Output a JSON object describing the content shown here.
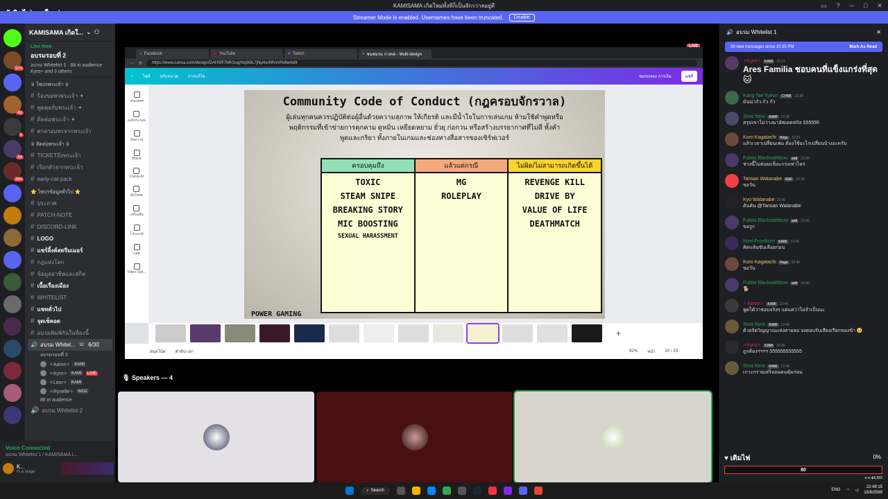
{
  "window": {
    "title": "KAMISAMA เกิดใหม่ทั้งทีก็เป็นจักรวาลอยู่ดี",
    "overlay_title": "ผู้เดิมไฟรายใหญ่",
    "controls": [
      "▭",
      "?",
      "─",
      "□",
      "✕"
    ]
  },
  "streamer": {
    "text": "Streamer Mode is enabled. Usernames have been truncated.",
    "disable_label": "Disable"
  },
  "server": {
    "name": "KAMISAMA เกิดใ...",
    "live_now": "Live Now",
    "stage_title": "อบรมรอบที่ 2",
    "audience": "อบรม Whitelist 1 · 88 in audience",
    "others": "Kyro+ and 3 others"
  },
  "channels": [
    {
      "kind": "cat",
      "label": "♛ ไซบรพระเจ้า ♛"
    },
    {
      "kind": "ch",
      "label": "ร้องขอพรพระเจ้า ✦"
    },
    {
      "kind": "ch",
      "label": "พูดคุยกับพระเจ้า ✦"
    },
    {
      "kind": "ch",
      "label": "ติดต่อพระเจ้า ✦"
    },
    {
      "kind": "ch",
      "label": "ศาลาอบพรจากพระเจ้า"
    },
    {
      "kind": "cat",
      "label": "♛ ติดต่อพระเจ้า ♛"
    },
    {
      "kind": "ch",
      "label": "TICKETถึงพระเจ้า"
    },
    {
      "kind": "ch",
      "label": "เรียกตัวจากพระเจ้า"
    },
    {
      "kind": "ch",
      "label": "early-cat-pack"
    },
    {
      "kind": "cat",
      "label": "⭐ ไซบรข้อมูลทั่วไป ⭐"
    },
    {
      "kind": "ch",
      "label": "ประกาศ"
    },
    {
      "kind": "ch",
      "label": "PATCH-NOTE"
    },
    {
      "kind": "ch",
      "label": "DISCORD-LINK"
    },
    {
      "kind": "ch",
      "label": "LOGO",
      "w": true
    },
    {
      "kind": "ch",
      "label": "แชร์ลิ้งค์สตรีมเมอร์",
      "w": true
    },
    {
      "kind": "ch",
      "label": "กฎแห่งโลก"
    },
    {
      "kind": "ch",
      "label": "ข้อมูลอาชีพและสกิล"
    },
    {
      "kind": "ch",
      "label": "เนื้อเรื่องเมือง",
      "w": true
    },
    {
      "kind": "ch",
      "label": "WHITELIST"
    },
    {
      "kind": "ch",
      "label": "แชทคั่วไป",
      "w": true
    },
    {
      "kind": "ch",
      "label": "จุดเช็คอต",
      "w": true
    },
    {
      "kind": "ch",
      "label": "อบรมพิมพ์กันในห้องนี้"
    }
  ],
  "voice_channel": {
    "name": "อบรม Whitel...",
    "count": "92",
    "limit": "6/30",
    "sub": "อบรมรอบที่ 2",
    "users": [
      {
        "name": "✧Aaron✧",
        "tag": "KAMI"
      },
      {
        "name": "✧Kyro✧",
        "tag": "KAMI",
        "live": "LIVE"
      },
      {
        "name": "✧Leor✧",
        "tag": "KAMI"
      },
      {
        "name": "✧Rynelle✧",
        "tag": "WOZ"
      }
    ],
    "audience": "88 in audience",
    "next": "อบรม Whitelist 2"
  },
  "voice_status": {
    "state": "Voice Connected",
    "sub": "อบรม Whitelist 1 / KAMISAMA L...",
    "user": "K...",
    "user_sub": "In a stage"
  },
  "browser": {
    "tabs": [
      "Facebook",
      "YouTube",
      "Twitch",
      "ชนชมรม กาสเด - Multi-design"
    ],
    "url": "https://www.canva.com/design/DAHSR7MKSug/Nq9ML7jNjAhoNfVmPk8w/edit",
    "live_badge": "LIVE"
  },
  "canva": {
    "top": [
      "ไฟล์",
      "ปรับขนาด",
      "การแก้ไข"
    ],
    "share": "แชร์",
    "user": "ชมรมของ การเงิน",
    "side": [
      "เทมเพลต",
      "องค์ประกอบ",
      "ข้อความ",
      "Brand",
      "Canva AI",
      "อัปโหลด",
      "เครื่องมือ",
      "โปรเจกต์",
      "แอพ",
      "Video Opti..."
    ],
    "notes": "สมุดโน้ต",
    "timer": "ตัวจับเวลา",
    "zoom": "62%",
    "pages": "20 / 23",
    "page_label": "หน้า"
  },
  "slide": {
    "title": "Community Code of Conduct (กฎครอบจักรวาล)",
    "desc": "ผู้เล่นทุกคนควรปฏิบัติต่อผู้อื่นด้วยความสุภาพ ให้เกียรติ และมีน้ำใจในการเล่นเกม ห้ามใช้คำพูดหรือพฤติกรรมที่เข้าข่ายการคุกคาม ดูหมิ่น เหยียดหยาม ยั่วยุ ก่อกวน หรือสร้างบรรยากาศที่ไม่ดี ทั้งคำพูดและกริยา ทั้งภายในเกมและช่องทางสื่อสารของเซิร์ฟเวอร์",
    "columns": [
      {
        "header": "ครอบคุมถึง",
        "color": "#93dfb8",
        "items": [
          "TOXIC",
          "STEAM SNIPE",
          "BREAKING STORY",
          "MIC BOOSTING",
          "SEXUAL HARASSMENT"
        ]
      },
      {
        "header": "แล้วแต่กรณี",
        "color": "#f4a97f",
        "items": [
          "MG",
          "ROLEPLAY"
        ]
      },
      {
        "header": "ไม่ผิด/ไม่สามารถเกิดขึ้นได้",
        "color": "#f8d32e",
        "items": [
          "REVENGE KILL",
          "DRIVE BY",
          "VALUE OF LIFE",
          "DEATHMATCH"
        ]
      }
    ],
    "footer": "POWER GAMING"
  },
  "stage": {
    "speakers": "Speakers — 4"
  },
  "chat": {
    "title": "อบรม Whitelist 1",
    "new_msgs": "50 new messages since 10:35 PM",
    "mark_read": "Mark As Read",
    "messages": [
      {
        "name": "✧Kyro✧",
        "tag": "KAMI",
        "time": "22:37",
        "text": "Ares Familia ชอบคนที่แข็งแกร่งที่สุด 🐱",
        "big": true,
        "color": "#e91e63"
      },
      {
        "name": "Kang Tae hyeon",
        "tag": "CYBR",
        "time": "22:38",
        "text": "มันน่ากัว กัว กัว",
        "color": "#23a55a"
      },
      {
        "name": "Sora Itano",
        "tag": "KAMI",
        "time": "22:38",
        "text": "สรุปเขาไม่ว่างมาอัพเดตสกิล 555555",
        "color": "#23a55a"
      },
      {
        "name": "Kuro Kagatachi",
        "tag": "Hogs",
        "time": "22:39",
        "text": "แล้วเวลาเปลี่ยนเฟม ต้องใช้อะไรเปลี่ยนบ้างอะครับ",
        "color": "#e5c07b"
      },
      {
        "name": "Fubito Blackoathbow",
        "tag": "add",
        "time": "22:39",
        "text": "ช่วงนี้ไม่ค่อยแข็งแกร่งเท่าไหร่",
        "color": "#23a55a"
      },
      {
        "name": "Tansan Watanabe",
        "tag": "RAF",
        "time": "22:39",
        "text": "ขอวัน",
        "color": "#e5c07b"
      },
      {
        "name": "Kyo Watanabe",
        "tag": "",
        "time": "22:40",
        "text": "ดันดัน @Tansan Watanabe",
        "color": "#e5c07b"
      },
      {
        "name": "Fubito Blackoathbow",
        "tag": "add",
        "time": "22:40",
        "text": "ขอรูก",
        "color": "#23a55a"
      },
      {
        "name": "Noel Frostborn",
        "tag": "KAMI",
        "time": "22:40",
        "text": "คิดแล้นขับเลือยก่อน",
        "color": "#23a55a"
      },
      {
        "name": "Kuro Kagatachi",
        "tag": "Hogs",
        "time": "22:40",
        "text": "ขอวัน",
        "color": "#e5c07b"
      },
      {
        "name": "Fubito Blackoathbow",
        "tag": "add",
        "time": "22:40",
        "text": "🐕",
        "color": "#23a55a"
      },
      {
        "name": "✧Aaron✧",
        "tag": "KAMI",
        "time": "22:40",
        "text": "พูดได้ว่าชอบจริงๆ แต่แค่ว่าไม่จำเป็นนะ",
        "color": "#e91e63"
      },
      {
        "name": "Sora Itano",
        "tag": "KAMI",
        "time": "22:40",
        "text": "ด้วยจิตวิญญาณแห่งสายลม จงตอบรับเสียงเรียกของข้า 🥺",
        "color": "#23a55a"
      },
      {
        "name": "✧Kyro✧",
        "tag": "KAMI",
        "time": "22:40",
        "text": "ถูกต้องฯฯฯฯ 555555555555",
        "color": "#e91e63"
      },
      {
        "name": "Sora Itano",
        "tag": "KAMI",
        "time": "22:40",
        "text": "เกาะกร่ายเสร็จอนคนคุ้มก่อน",
        "color": "#23a55a"
      }
    ]
  },
  "fund": {
    "label": "♥ เติมไฟ",
    "percent": "0%",
    "value": "80",
    "sub": "จาก ฿5,555"
  },
  "taskbar": {
    "search": "Search",
    "lang": "ENG",
    "time": "22:49:15",
    "date": "15/8/2569"
  }
}
